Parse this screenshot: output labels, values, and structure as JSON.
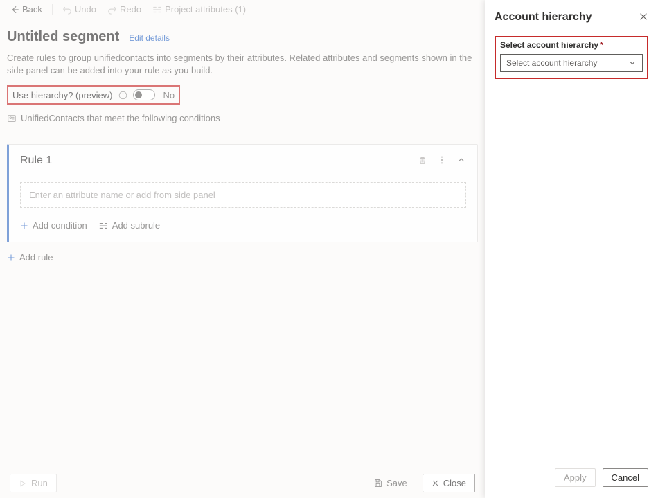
{
  "toolbar": {
    "back": "Back",
    "undo": "Undo",
    "redo": "Redo",
    "project_attributes": "Project attributes (1)"
  },
  "header": {
    "title": "Untitled segment",
    "edit_link": "Edit details",
    "description": "Create rules to group unifiedcontacts into segments by their attributes. Related attributes and segments shown in the side panel can be added into your rule as you build."
  },
  "hierarchy": {
    "label": "Use hierarchy? (preview)",
    "state": "No"
  },
  "conditions_text": "UnifiedContacts that meet the following conditions",
  "rule": {
    "title": "Rule 1",
    "placeholder": "Enter an attribute name or add from side panel",
    "add_condition": "Add condition",
    "add_subrule": "Add subrule"
  },
  "add_rule": "Add rule",
  "footer": {
    "run": "Run",
    "save": "Save",
    "close": "Close"
  },
  "panel": {
    "title": "Account hierarchy",
    "field_label": "Select account hierarchy",
    "select_placeholder": "Select account hierarchy",
    "apply": "Apply",
    "cancel": "Cancel"
  }
}
